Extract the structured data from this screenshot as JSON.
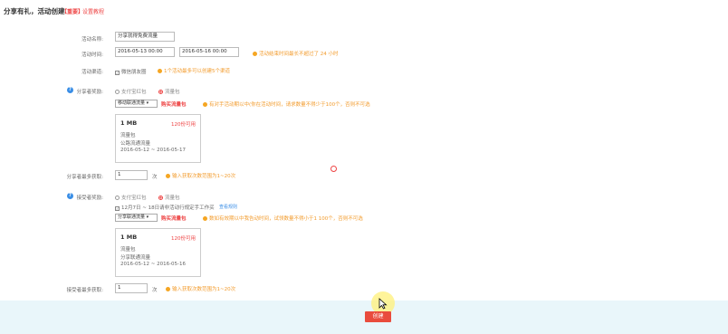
{
  "header": {
    "title": "分享有礼，活动创建",
    "tag": "【重要】",
    "tag_link": "设置教程"
  },
  "form": {
    "name": {
      "label": "活动名称:",
      "value": "分享就得免费流量"
    },
    "time": {
      "label": "活动时间:",
      "start": "2016-05-13 00:00",
      "end": "2016-05-16 00:00",
      "tip": "活动结束时间最长不超过了 24 小时"
    },
    "share": {
      "label": "活动渠道:",
      "checkbox": "微信朋友圈",
      "tip": "1个活动最多可以创建5个渠道"
    },
    "sharer_reward": {
      "label": "分享者奖励:",
      "options": [
        "支付宝红包",
        "流量包"
      ],
      "select": "移动联通流量",
      "link": "购买流量包",
      "tip": "有对手活动期以中(你在活动时间，请求数量不得少于100个，否则不可选"
    },
    "card1": {
      "size": "1 MB",
      "avail": "120份可用",
      "line1": "流量包",
      "line2": "公路流通流量",
      "line3": "2016-05-12 ~ 2016-05-17"
    },
    "sharer_limit": {
      "label": "分享者最多获取:",
      "value": "1",
      "unit": "次",
      "tip": "输入获取次数范围为1~20次"
    },
    "receiver_reward": {
      "label": "接受者奖励:",
      "options": [
        "支付宝红包",
        "流量包"
      ],
      "checkbox": "12月7日 ~ 18日请非活动行规定手工作买",
      "checkbox_link": "查看规则",
      "select": "分享联通流量",
      "link": "购买流量包",
      "tip": "数如有效期以中我告动时间，试领数量不得小于1 100个，否则不可选"
    },
    "card2": {
      "size": "1 MB",
      "avail": "120份可用",
      "line1": "流量包",
      "line2": "分享联通流量",
      "line3": "2016-05-12 ~ 2016-05-16"
    },
    "receiver_limit": {
      "label": "接受者最多获取:",
      "value": "1",
      "unit": "次",
      "tip": "输入获取次数范围为1~20次"
    }
  },
  "submit_label": "创建",
  "colors": {
    "accent": "#e94c3d",
    "warning": "#f29b2c",
    "link": "#3a8ee6",
    "background": "#e9f6fa"
  }
}
